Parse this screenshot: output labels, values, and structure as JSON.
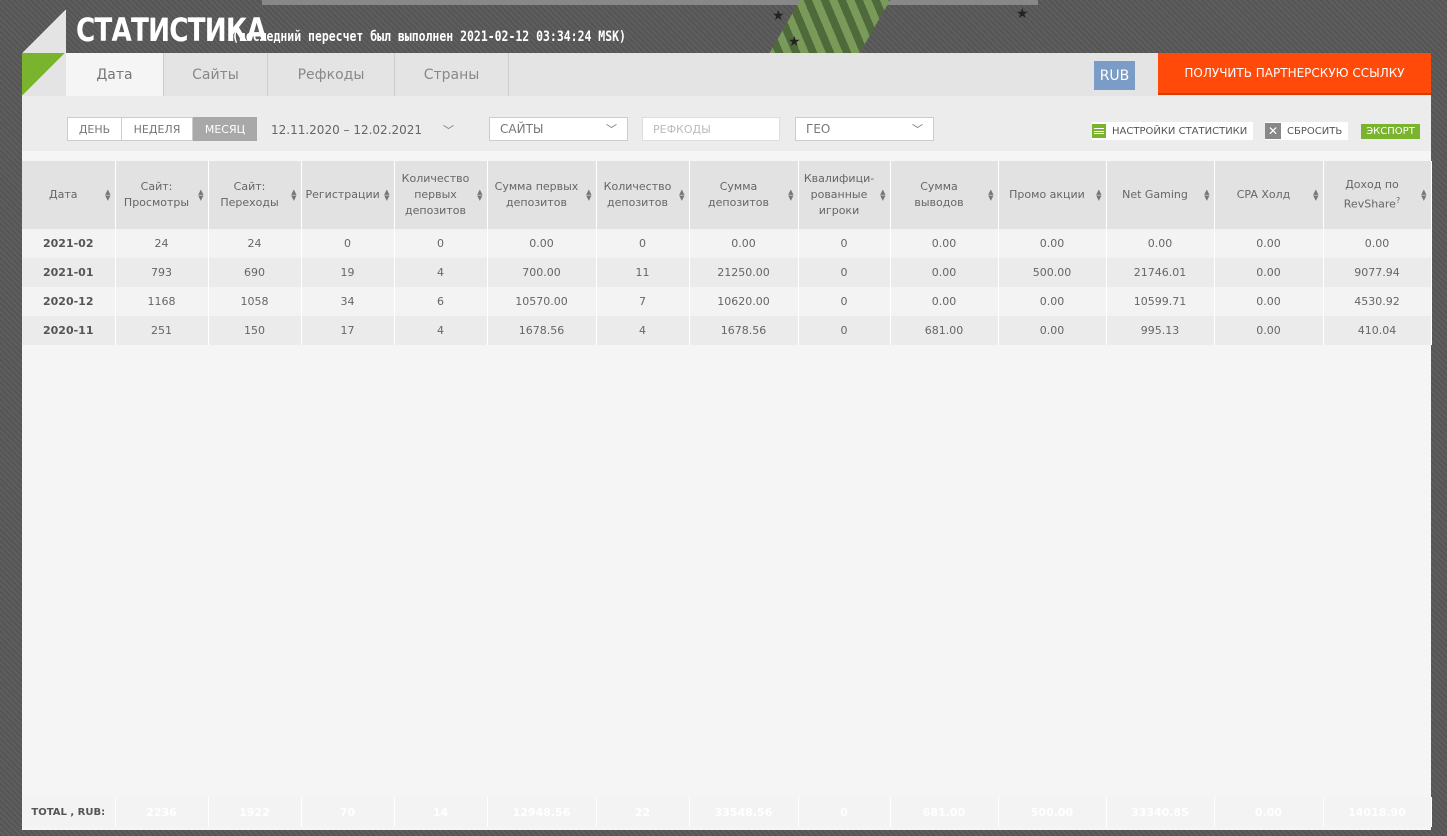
{
  "header": {
    "title": "Статистика",
    "recalc": "(последний пересчет был выполнен 2021-02-12 03:34:24 MSK)"
  },
  "tabs": [
    {
      "label": "Дата",
      "active": true
    },
    {
      "label": "Сайты",
      "active": false
    },
    {
      "label": "Рефкоды",
      "active": false
    },
    {
      "label": "Страны",
      "active": false
    }
  ],
  "currency": "RUB",
  "partner_link_label": "ПОЛУЧИТЬ ПАРТНЕРСКУЮ ССЫЛКУ",
  "filters": {
    "period_day": "ДЕНЬ",
    "period_week": "НЕДЕЛЯ",
    "period_month": "МЕСЯЦ",
    "date_range": "12.11.2020  –  12.02.2021",
    "sites_select": "САЙТЫ",
    "refcodes_placeholder": "РЕФКОДЫ",
    "geo_select": "ГЕО",
    "settings_label": "НАСТРОЙКИ СТАТИСТИКИ",
    "reset_label": "СБРОСИТЬ",
    "export_label": "ЭКСПОРТ"
  },
  "columns": [
    "Дата",
    "Сайт: Просмотры",
    "Сайт: Переходы",
    "Регистрации",
    "Количество первых депозитов",
    "Сумма первых депозитов",
    "Количество депозитов",
    "Сумма депозитов",
    "Квалифици-рованные игроки",
    "Сумма выводов",
    "Промо акции",
    "Net Gaming",
    "CPA Холд",
    "Доход по RevShare"
  ],
  "revshare_help": "?",
  "rows": [
    [
      "2021-02",
      "24",
      "24",
      "0",
      "0",
      "0.00",
      "0",
      "0.00",
      "0",
      "0.00",
      "0.00",
      "0.00",
      "0.00",
      "0.00"
    ],
    [
      "2021-01",
      "793",
      "690",
      "19",
      "4",
      "700.00",
      "11",
      "21250.00",
      "0",
      "0.00",
      "500.00",
      "21746.01",
      "0.00",
      "9077.94"
    ],
    [
      "2020-12",
      "1168",
      "1058",
      "34",
      "6",
      "10570.00",
      "7",
      "10620.00",
      "0",
      "0.00",
      "0.00",
      "10599.71",
      "0.00",
      "4530.92"
    ],
    [
      "2020-11",
      "251",
      "150",
      "17",
      "4",
      "1678.56",
      "4",
      "1678.56",
      "0",
      "681.00",
      "0.00",
      "995.13",
      "0.00",
      "410.04"
    ]
  ],
  "total": [
    "TOTAL , RUB:",
    "2236",
    "1922",
    "70",
    "14",
    "12948.56",
    "22",
    "33548.56",
    "0",
    "681.00",
    "500.00",
    "33340.85",
    "0.00",
    "14018.90"
  ]
}
